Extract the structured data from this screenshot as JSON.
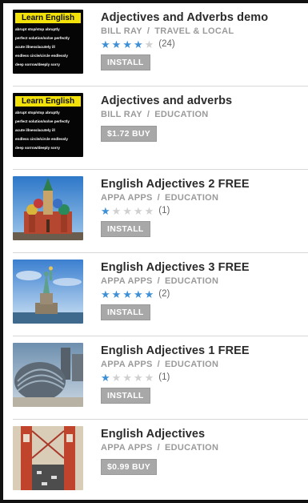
{
  "apps": [
    {
      "title": "Adjectives and Adverbs demo",
      "developer": "BILL RAY",
      "category": "TRAVEL & LOCAL",
      "rating": 4,
      "rating_count": "(24)",
      "button_label": "INSTALL",
      "thumb_icon": "learn-english",
      "thumb_heading": "Learn English",
      "thumb_lines": [
        "abrupt stop/stop abruptly",
        "perfect solution/solve perfectly",
        "acute illness/acutely ill",
        "endless circle/circle endlessly",
        "deep sorrow/deeply sorry"
      ]
    },
    {
      "title": "Adjectives and adverbs",
      "developer": "BILL RAY",
      "category": "EDUCATION",
      "rating": null,
      "rating_count": "",
      "button_label": "$1.72 BUY",
      "thumb_icon": "learn-english",
      "thumb_heading": "Learn English",
      "thumb_lines": [
        "abrupt stop/stop abruptly",
        "perfect solution/solve perfectly",
        "acute illness/acutely ill",
        "endless circle/circle endlessly",
        "deep sorrow/deeply sorry"
      ]
    },
    {
      "title": "English Adjectives 2 FREE",
      "developer": "APPA APPS",
      "category": "EDUCATION",
      "rating": 1,
      "rating_count": "(1)",
      "button_label": "INSTALL",
      "thumb_icon": "st-basils-cathedral"
    },
    {
      "title": "English Adjectives 3 FREE",
      "developer": "APPA APPS",
      "category": "EDUCATION",
      "rating": 5,
      "rating_count": "(2)",
      "button_label": "INSTALL",
      "thumb_icon": "statue-of-liberty"
    },
    {
      "title": "English Adjectives 1 FREE",
      "developer": "APPA APPS",
      "category": "EDUCATION",
      "rating": 1,
      "rating_count": "(1)",
      "button_label": "INSTALL",
      "thumb_icon": "london-city-hall"
    },
    {
      "title": "English Adjectives",
      "developer": "APPA APPS",
      "category": "EDUCATION",
      "rating": null,
      "rating_count": "",
      "button_label": "$0.99 BUY",
      "thumb_icon": "golden-gate-bridge"
    }
  ],
  "colors": {
    "star_on": "#3d8fd6",
    "star_off": "#d0d0d0",
    "button_bg": "#a8a8a8"
  }
}
